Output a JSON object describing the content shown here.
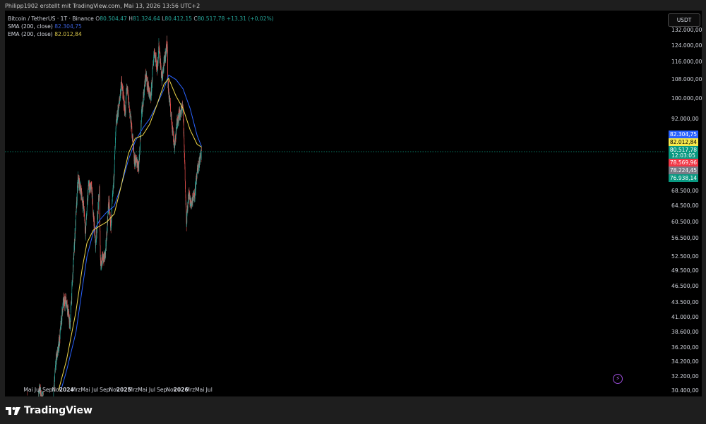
{
  "attribution": "Philipp1902 erstellt mit TradingView.com, Mai 13, 2026 13:56 UTC+2",
  "brand": "TradingView",
  "legend": {
    "symbol": "Bitcoin / TetherUS · 1T · Binance",
    "ohlc": [
      {
        "k": "O",
        "v": "80.504,47"
      },
      {
        "k": "H",
        "v": "81.324,64"
      },
      {
        "k": "L",
        "v": "80.412,15"
      },
      {
        "k": "C",
        "v": "80.517,78"
      }
    ],
    "change": "+13,31 (+0,02%)",
    "sma_label": "SMA (200, close)",
    "sma_value": "82.304,75",
    "ema_label": "EMA (200, close)",
    "ema_value": "82.012,84"
  },
  "currency_button": "USDT",
  "icons": {
    "bolt": "lightning-icon",
    "logo": "tradingview-logo-icon"
  },
  "colors": {
    "up": "#26a69a",
    "down": "#ef5350",
    "sma": "#2962ff",
    "ema": "#f0d84a",
    "tag_sma": "#2962ff",
    "tag_ema": "#f7e84b",
    "tag_close": "#089981",
    "tag_high": "#f23645",
    "tag_mid": "#787b86",
    "tag_low": "#089981"
  },
  "price_tags": [
    {
      "id": "sma",
      "label": "82.304,75"
    },
    {
      "id": "ema",
      "label": "82.012,84"
    },
    {
      "id": "close",
      "label": "80.517,78"
    },
    {
      "id": "countdown",
      "label": "12:03:05"
    },
    {
      "id": "high",
      "label": "78.569,96"
    },
    {
      "id": "mid",
      "label": "78.224,45"
    },
    {
      "id": "low",
      "label": "76.938,14"
    }
  ],
  "chart_data": {
    "type": "candlestick",
    "log_scale": true,
    "y_ticks": [
      "132.000,00",
      "124.000,00",
      "116.000,00",
      "108.000,00",
      "100.000,00",
      "92.000,00",
      "68.500,00",
      "64.500,00",
      "60.500,00",
      "56.500,00",
      "52.500,00",
      "49.500,00",
      "46.500,00",
      "43.500,00",
      "41.000,00",
      "38.600,00",
      "36.200,00",
      "34.200,00",
      "32.200,00",
      "30.400,00"
    ],
    "x_ticks": [
      {
        "label": "Mai",
        "bold": false
      },
      {
        "label": "Jul",
        "bold": false
      },
      {
        "label": "Sep",
        "bold": false
      },
      {
        "label": "Nov",
        "bold": false
      },
      {
        "label": "2024",
        "bold": true
      },
      {
        "label": "Mrz",
        "bold": false
      },
      {
        "label": "Mai",
        "bold": false
      },
      {
        "label": "Jul",
        "bold": false
      },
      {
        "label": "Sep",
        "bold": false
      },
      {
        "label": "Nov",
        "bold": false
      },
      {
        "label": "2025",
        "bold": true
      },
      {
        "label": "Mrz",
        "bold": false
      },
      {
        "label": "Mai",
        "bold": false
      },
      {
        "label": "Jul",
        "bold": false
      },
      {
        "label": "Sep",
        "bold": false
      },
      {
        "label": "Nov",
        "bold": false
      },
      {
        "label": "2026",
        "bold": true
      },
      {
        "label": "Mrz",
        "bold": false
      },
      {
        "label": "Mai",
        "bold": false
      },
      {
        "label": "Jul",
        "bold": false
      }
    ],
    "price_path": [
      [
        "2023-04-15",
        29000
      ],
      [
        "2023-05-01",
        28500
      ],
      [
        "2023-06-15",
        26500
      ],
      [
        "2023-07-10",
        30400
      ],
      [
        "2023-08-01",
        29300
      ],
      [
        "2023-09-01",
        26000
      ],
      [
        "2023-10-01",
        27500
      ],
      [
        "2023-10-25",
        34300
      ],
      [
        "2023-11-15",
        37000
      ],
      [
        "2023-12-10",
        43500
      ],
      [
        "2024-01-01",
        44000
      ],
      [
        "2024-01-23",
        39500
      ],
      [
        "2024-02-15",
        52000
      ],
      [
        "2024-03-14",
        72000
      ],
      [
        "2024-04-01",
        69000
      ],
      [
        "2024-04-20",
        64000
      ],
      [
        "2024-05-01",
        58000
      ],
      [
        "2024-05-20",
        70000
      ],
      [
        "2024-06-10",
        69000
      ],
      [
        "2024-07-05",
        55000
      ],
      [
        "2024-07-29",
        69000
      ],
      [
        "2024-08-05",
        51000
      ],
      [
        "2024-09-06",
        53000
      ],
      [
        "2024-09-27",
        66000
      ],
      [
        "2024-10-10",
        59000
      ],
      [
        "2024-10-29",
        72000
      ],
      [
        "2024-11-13",
        90000
      ],
      [
        "2024-12-05",
        99000
      ],
      [
        "2024-12-17",
        107000
      ],
      [
        "2025-01-10",
        94000
      ],
      [
        "2025-01-21",
        105000
      ],
      [
        "2025-02-25",
        86000
      ],
      [
        "2025-03-10",
        78000
      ],
      [
        "2025-04-07",
        76000
      ],
      [
        "2025-04-25",
        94000
      ],
      [
        "2025-05-22",
        110000
      ],
      [
        "2025-06-22",
        99000
      ],
      [
        "2025-07-14",
        122000
      ],
      [
        "2025-08-03",
        113000
      ],
      [
        "2025-08-14",
        124000
      ],
      [
        "2025-09-01",
        108000
      ],
      [
        "2025-10-06",
        126000
      ],
      [
        "2025-10-10",
        106000
      ],
      [
        "2025-11-21",
        82000
      ],
      [
        "2025-12-10",
        92000
      ],
      [
        "2026-01-14",
        97000
      ],
      [
        "2026-02-06",
        60500
      ],
      [
        "2026-02-20",
        68000
      ],
      [
        "2026-03-06",
        65000
      ],
      [
        "2026-04-01",
        68500
      ],
      [
        "2026-04-20",
        75000
      ],
      [
        "2026-05-13",
        80517
      ]
    ],
    "sma_200_path": [
      [
        "2023-11-25",
        30400
      ],
      [
        "2024-01-01",
        33000
      ],
      [
        "2024-03-01",
        38600
      ],
      [
        "2024-04-10",
        46000
      ],
      [
        "2024-05-10",
        52500
      ],
      [
        "2024-06-20",
        58000
      ],
      [
        "2024-08-01",
        61000
      ],
      [
        "2024-09-15",
        63000
      ],
      [
        "2024-11-01",
        64500
      ],
      [
        "2024-12-15",
        70000
      ],
      [
        "2025-01-31",
        78000
      ],
      [
        "2025-03-15",
        84000
      ],
      [
        "2025-05-01",
        88500
      ],
      [
        "2025-06-15",
        92000
      ],
      [
        "2025-08-01",
        97500
      ],
      [
        "2025-09-15",
        104000
      ],
      [
        "2025-10-15",
        110000
      ],
      [
        "2025-12-01",
        108000
      ],
      [
        "2026-01-15",
        104000
      ],
      [
        "2026-03-01",
        96000
      ],
      [
        "2026-04-15",
        86000
      ],
      [
        "2026-05-13",
        82304
      ]
    ],
    "ema_200_path": [
      [
        "2023-11-10",
        30400
      ],
      [
        "2024-01-01",
        34500
      ],
      [
        "2024-03-01",
        42000
      ],
      [
        "2024-04-10",
        50000
      ],
      [
        "2024-05-10",
        55500
      ],
      [
        "2024-06-20",
        58500
      ],
      [
        "2024-08-01",
        59500
      ],
      [
        "2024-09-15",
        60500
      ],
      [
        "2024-11-01",
        62500
      ],
      [
        "2024-12-15",
        70000
      ],
      [
        "2025-01-31",
        80000
      ],
      [
        "2025-03-15",
        85000
      ],
      [
        "2025-05-01",
        86000
      ],
      [
        "2025-06-15",
        90000
      ],
      [
        "2025-08-01",
        97500
      ],
      [
        "2025-09-15",
        106000
      ],
      [
        "2025-10-15",
        108500
      ],
      [
        "2025-12-01",
        101000
      ],
      [
        "2026-01-15",
        96000
      ],
      [
        "2026-03-01",
        88000
      ],
      [
        "2026-04-15",
        83000
      ],
      [
        "2026-05-13",
        82013
      ]
    ]
  }
}
